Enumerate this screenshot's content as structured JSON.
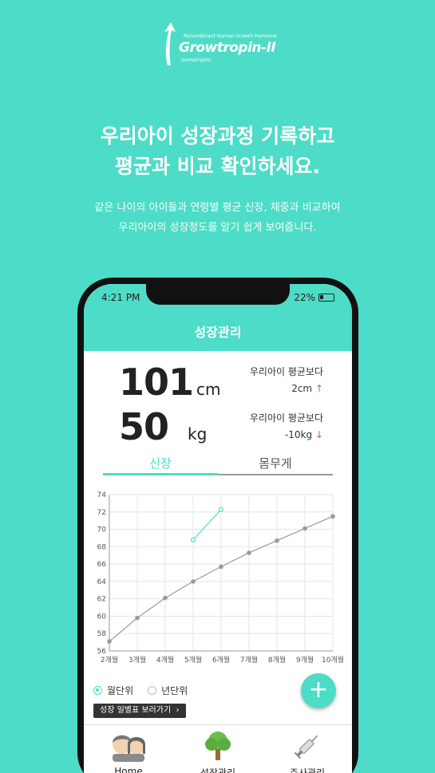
{
  "brand": {
    "tagline": "Recombinant Human Growth Hormone",
    "name": "Growtropin-II",
    "generic": "(somatropin)"
  },
  "headline": {
    "line1": "우리아이 성장과정 기록하고",
    "line2": "평균과 비교 확인하세요."
  },
  "subtext": {
    "line1": "같은 나이의 아이들과 연령별 평균 신장, 체중과 비교하여",
    "line2": "우리아이의 성장정도를 알기 쉽게 보여줍니다."
  },
  "status_bar": {
    "time": "4:21 PM",
    "battery": "22%"
  },
  "app_title": "성장관리",
  "height": {
    "value": "101",
    "unit": "cm",
    "compare_label": "우리아이 평균보다",
    "diff": "2cm",
    "arrow": "↑"
  },
  "weight": {
    "value": "50",
    "unit": "kg",
    "compare_label": "우리아이 평균보다",
    "diff": "-10kg",
    "arrow": "↓"
  },
  "tabs": [
    {
      "label": "신장",
      "active": true
    },
    {
      "label": "몸무게",
      "active": false
    }
  ],
  "chart_data": {
    "type": "line",
    "categories": [
      "2개월",
      "3개월",
      "4개월",
      "5개월",
      "6개월",
      "7개월",
      "8개월",
      "9개월",
      "10개월"
    ],
    "ylim": [
      56,
      74
    ],
    "yticks": [
      56,
      58,
      60,
      62,
      64,
      66,
      68,
      70,
      72,
      74
    ],
    "grid": true,
    "series": [
      {
        "values": [
          57.1,
          59.8,
          62.1,
          64.0,
          65.7,
          67.3,
          68.7,
          70.1,
          71.5
        ],
        "color": "#999999"
      },
      {
        "x_start_index": 3,
        "values": [
          68.8,
          72.3
        ],
        "color": "#4ddcc7"
      }
    ]
  },
  "radio_options": [
    {
      "label": "월단위",
      "selected": true
    },
    {
      "label": "년단위",
      "selected": false
    }
  ],
  "table_button": "성장 일별표 보러가기",
  "fab_label": "+",
  "nav": [
    {
      "label": "Home",
      "icon": "kids-icon"
    },
    {
      "label": "성장관리",
      "icon": "tree-icon"
    },
    {
      "label": "주사관리",
      "icon": "syringe-icon"
    }
  ],
  "colors": {
    "accent": "#4ddcc7",
    "up": "#3a8fd8",
    "down": "#e0487b",
    "series_gray": "#999999"
  }
}
